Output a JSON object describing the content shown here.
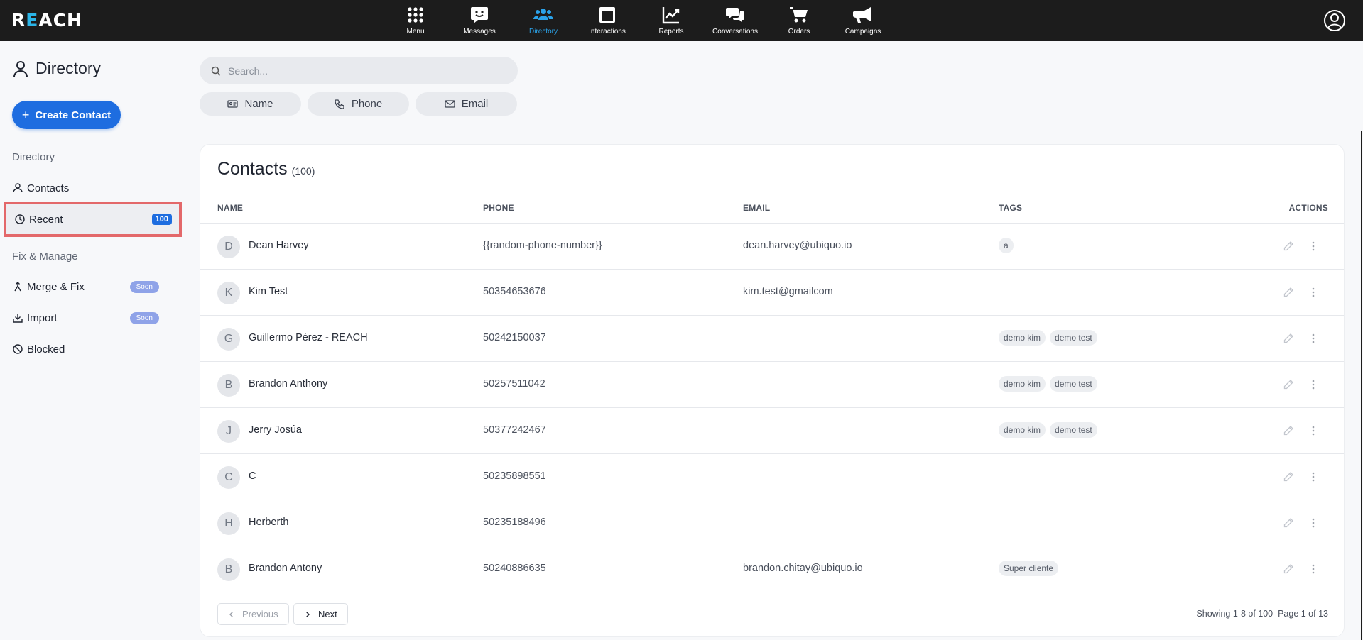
{
  "app": {
    "logo_left": "R",
    "logo_e": "E",
    "logo_right": "ACH"
  },
  "nav": [
    {
      "label": "Menu",
      "icon": "grid-icon"
    },
    {
      "label": "Messages",
      "icon": "message-smile-icon"
    },
    {
      "label": "Directory",
      "icon": "users-icon",
      "active": true
    },
    {
      "label": "Interactions",
      "icon": "window-icon"
    },
    {
      "label": "Reports",
      "icon": "chart-line-icon"
    },
    {
      "label": "Conversations",
      "icon": "chat-bubbles-icon"
    },
    {
      "label": "Orders",
      "icon": "cart-icon"
    },
    {
      "label": "Campaigns",
      "icon": "megaphone-icon"
    }
  ],
  "sidebar": {
    "title": "Directory",
    "create_label": "Create Contact",
    "section_directory": "Directory",
    "contacts": "Contacts",
    "recent": "Recent",
    "recent_count": "100",
    "section_fix": "Fix & Manage",
    "merge": "Merge & Fix",
    "merge_badge": "Soon",
    "import": "Import",
    "import_badge": "Soon",
    "blocked": "Blocked"
  },
  "search": {
    "placeholder": "Search..."
  },
  "filters": {
    "name": "Name",
    "phone": "Phone",
    "email": "Email"
  },
  "contacts": {
    "title": "Contacts",
    "count": "(100)",
    "columns": {
      "name": "NAME",
      "phone": "PHONE",
      "email": "EMAIL",
      "tags": "TAGS",
      "actions": "ACTIONS"
    },
    "rows": [
      {
        "initial": "D",
        "name": "Dean Harvey",
        "phone": "{{random-phone-number}}",
        "email": "dean.harvey@ubiquo.io",
        "tags": [
          "a"
        ]
      },
      {
        "initial": "K",
        "name": "Kim Test",
        "phone": "50354653676",
        "email": "kim.test@gmailcom",
        "tags": []
      },
      {
        "initial": "G",
        "name": "Guillermo Pérez - REACH",
        "phone": "50242150037",
        "email": "",
        "tags": [
          "demo kim",
          "demo test"
        ]
      },
      {
        "initial": "B",
        "name": "Brandon Anthony",
        "phone": "50257511042",
        "email": "",
        "tags": [
          "demo kim",
          "demo test"
        ]
      },
      {
        "initial": "J",
        "name": "Jerry Josúa",
        "phone": "50377242467",
        "email": "",
        "tags": [
          "demo kim",
          "demo test"
        ]
      },
      {
        "initial": "C",
        "name": "C",
        "phone": "50235898551",
        "email": "",
        "tags": []
      },
      {
        "initial": "H",
        "name": "Herberth",
        "phone": "50235188496",
        "email": "",
        "tags": []
      },
      {
        "initial": "B",
        "name": "Brandon Antony",
        "phone": "50240886635",
        "email": "brandon.chitay@ubiquo.io",
        "tags": [
          "Super cliente"
        ]
      }
    ],
    "pager": {
      "previous": "Previous",
      "next": "Next",
      "showing": "Showing 1-8 of 100",
      "page": "Page 1 of 13"
    }
  },
  "colors": {
    "accent": "#1e6de0",
    "active_nav": "#2ba3ea",
    "highlight": "#e3686a"
  }
}
